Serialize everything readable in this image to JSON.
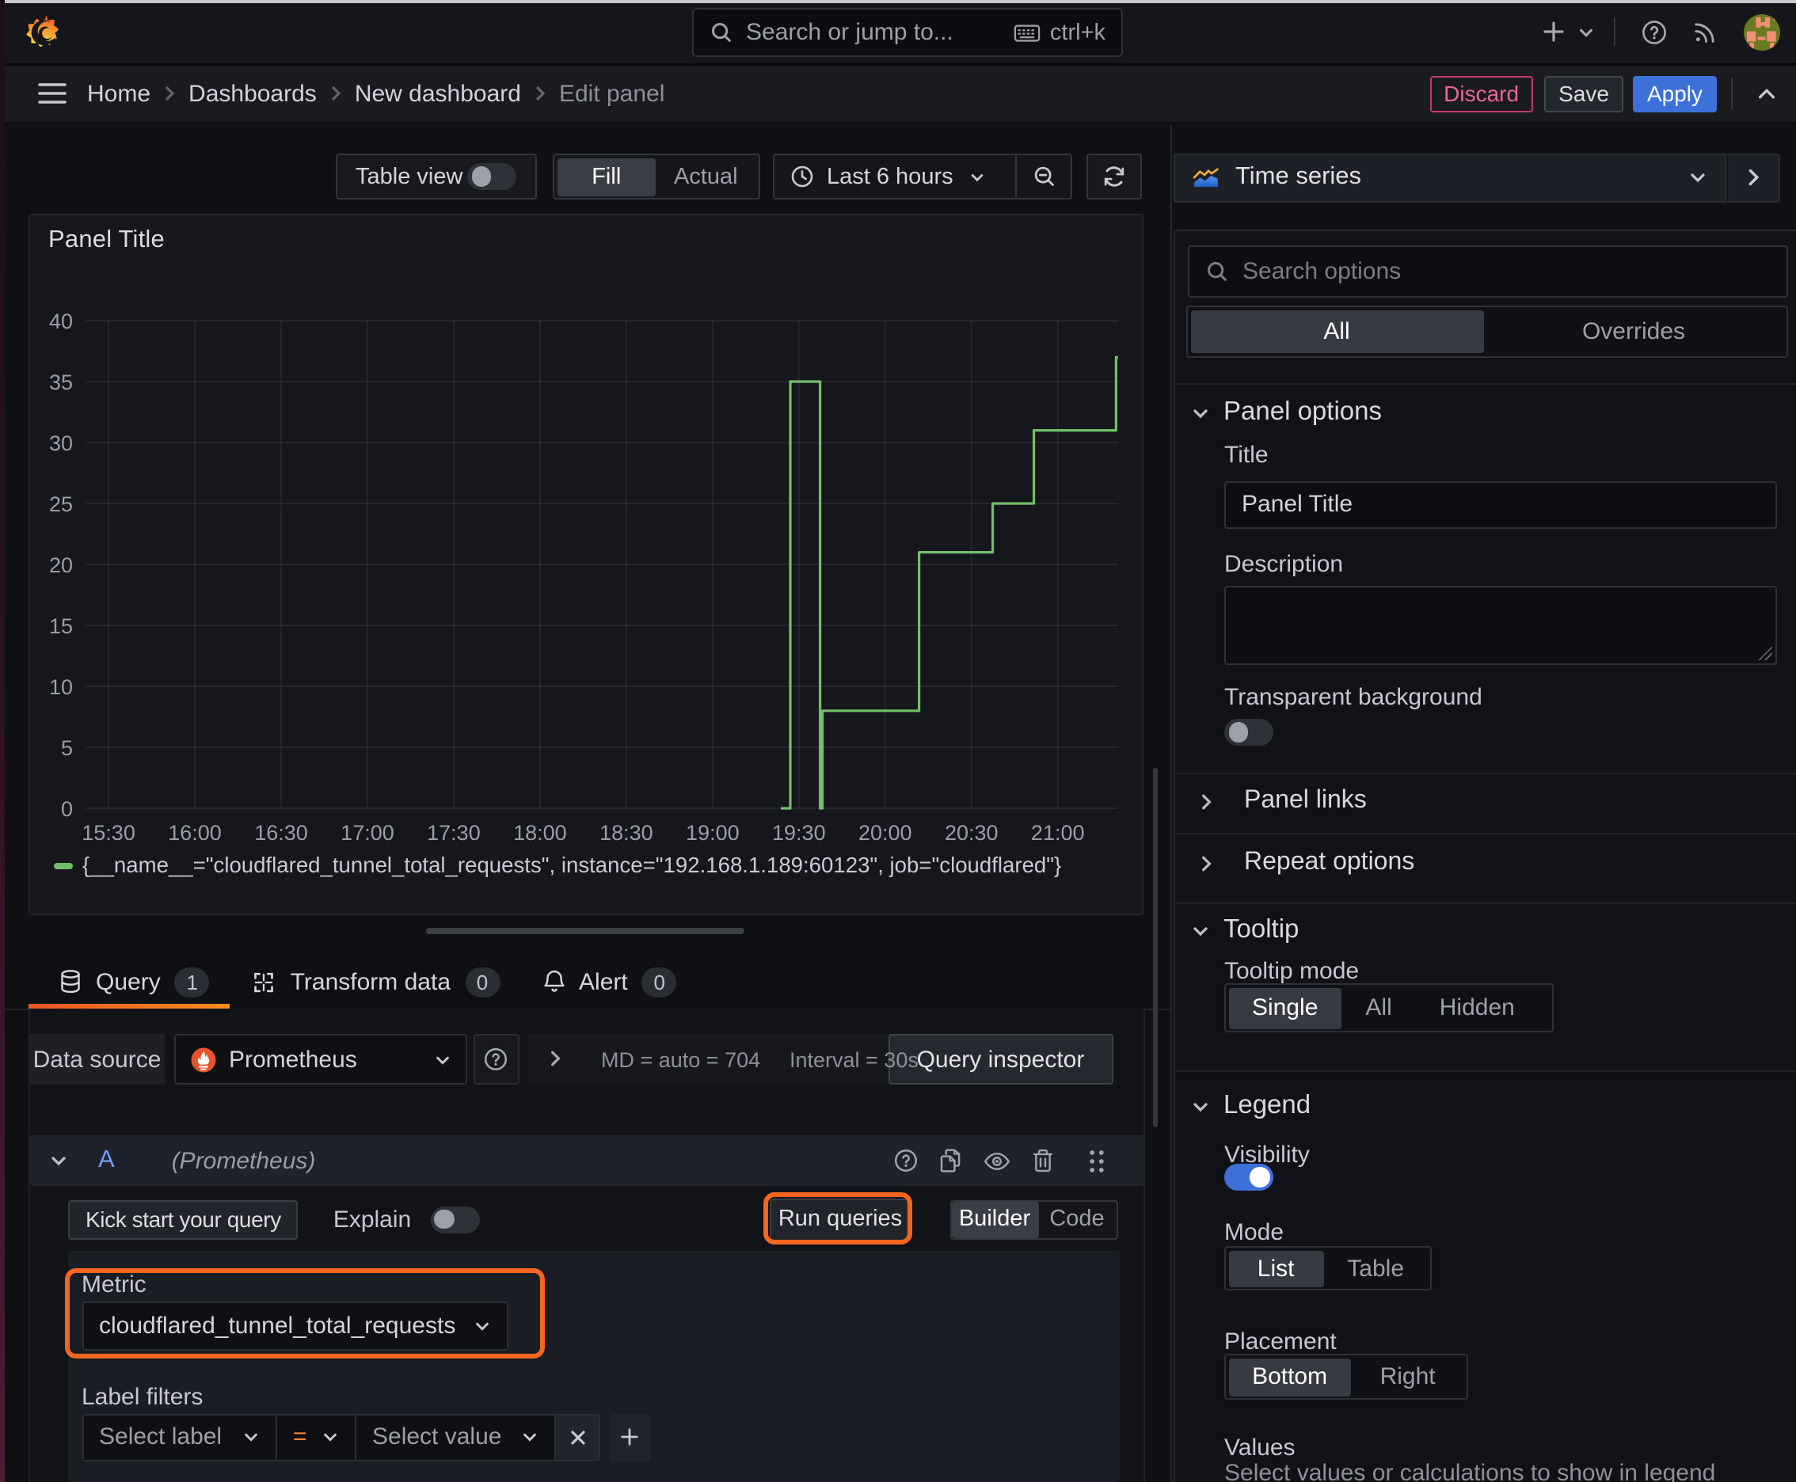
{
  "topbar": {
    "search_placeholder": "Search or jump to...",
    "shortcut": "ctrl+k"
  },
  "breadcrumbs": [
    "Home",
    "Dashboards",
    "New dashboard",
    "Edit panel"
  ],
  "nav_actions": {
    "discard": "Discard",
    "save": "Save",
    "apply": "Apply"
  },
  "toolbar": {
    "table_view_label": "Table view",
    "fill_label": "Fill",
    "actual_label": "Actual",
    "time_range_label": "Last 6 hours"
  },
  "viz_picker": {
    "label": "Time series"
  },
  "panel": {
    "title": "Panel Title"
  },
  "chart_data": {
    "type": "line",
    "style": "step",
    "title": "Panel Title",
    "line_color": "#73bf69",
    "grid": true,
    "x_min": 922,
    "x_max": 1281,
    "y_min": 0,
    "y_max": 40,
    "y_step": 5,
    "x_ticks": [
      {
        "m": 930,
        "label": "15:30"
      },
      {
        "m": 960,
        "label": "16:00"
      },
      {
        "m": 990,
        "label": "16:30"
      },
      {
        "m": 1020,
        "label": "17:00"
      },
      {
        "m": 1050,
        "label": "17:30"
      },
      {
        "m": 1080,
        "label": "18:00"
      },
      {
        "m": 1110,
        "label": "18:30"
      },
      {
        "m": 1140,
        "label": "19:00"
      },
      {
        "m": 1170,
        "label": "19:30"
      },
      {
        "m": 1200,
        "label": "20:00"
      },
      {
        "m": 1230,
        "label": "20:30"
      },
      {
        "m": 1260,
        "label": "21:00"
      }
    ],
    "series": [
      {
        "name": "{__name__=\"cloudflared_tunnel_total_requests\", instance=\"192.168.1.189:60123\", job=\"cloudflared\"}",
        "points": [
          [
            1163.7,
            0
          ],
          [
            1167,
            0
          ],
          [
            1167,
            35
          ],
          [
            1177.4,
            35
          ],
          [
            1177.4,
            0
          ],
          [
            1178.2,
            0
          ],
          [
            1178.2,
            8
          ],
          [
            1211.8,
            8
          ],
          [
            1211.8,
            21
          ],
          [
            1237.4,
            21
          ],
          [
            1237.4,
            25
          ],
          [
            1251.7,
            25
          ],
          [
            1251.7,
            31
          ],
          [
            1280.3,
            31
          ],
          [
            1280.3,
            37
          ],
          [
            1281,
            37
          ]
        ]
      }
    ]
  },
  "legend": {
    "series_label": "{__name__=\"cloudflared_tunnel_total_requests\", instance=\"192.168.1.189:60123\", job=\"cloudflared\"}"
  },
  "tabs": [
    {
      "label": "Query",
      "badge": "1"
    },
    {
      "label": "Transform data",
      "badge": "0"
    },
    {
      "label": "Alert",
      "badge": "0"
    }
  ],
  "datasource_row": {
    "label": "Data source",
    "value": "Prometheus",
    "stats_md": "MD = auto = 704",
    "stats_interval": "Interval = 30s",
    "inspector_label": "Query inspector"
  },
  "query_editor": {
    "ref_id": "A",
    "ds_name": "(Prometheus)",
    "kick_start_label": "Kick start your query",
    "explain_label": "Explain",
    "run_queries_label": "Run queries",
    "builder_label": "Builder",
    "code_label": "Code",
    "metric_label": "Metric",
    "metric_value": "cloudflared_tunnel_total_requests",
    "label_filters_label": "Label filters",
    "select_label_placeholder": "Select label",
    "operator_value": "=",
    "select_value_placeholder": "Select value"
  },
  "options_pane": {
    "search_placeholder": "Search options",
    "tab_all": "All",
    "tab_overrides": "Overrides",
    "panel_options": {
      "header": "Panel options",
      "title_label": "Title",
      "title_value": "Panel Title",
      "description_label": "Description",
      "transparent_label": "Transparent background"
    },
    "panel_links_header": "Panel links",
    "repeat_options_header": "Repeat options",
    "tooltip": {
      "header": "Tooltip",
      "mode_label": "Tooltip mode",
      "options": [
        "Single",
        "All",
        "Hidden"
      ],
      "selected": "Single"
    },
    "legend": {
      "header": "Legend",
      "visibility_label": "Visibility",
      "mode_label": "Mode",
      "mode_options": [
        "List",
        "Table"
      ],
      "mode_selected": "List",
      "placement_label": "Placement",
      "placement_options": [
        "Bottom",
        "Right"
      ],
      "placement_selected": "Bottom",
      "values_label": "Values",
      "values_hint": "Select values or calculations to show in legend"
    }
  },
  "colors": {
    "accent_orange": "#ff780a",
    "annotation_orange": "#f4661f",
    "apply_blue": "#3d71d9",
    "discard_pink": "#ef6398",
    "series_green": "#73bf69",
    "prometheus_orange": "#e6522c"
  }
}
